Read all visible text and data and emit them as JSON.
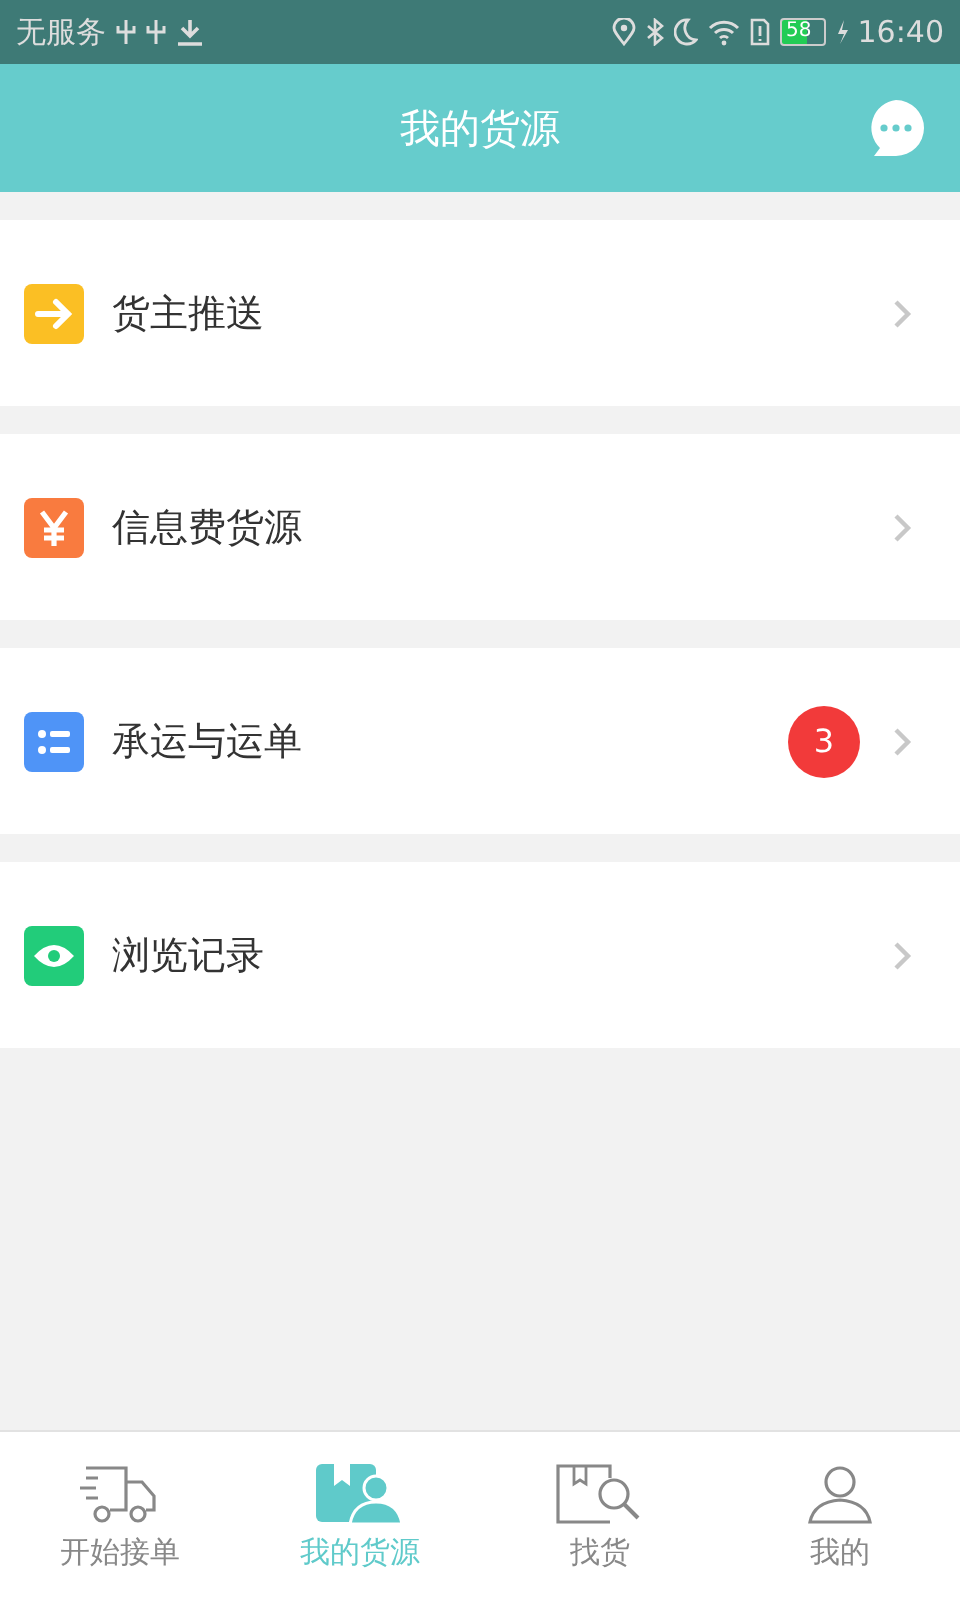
{
  "status_bar": {
    "carrier": "无服务",
    "battery": "58",
    "time": "16:40"
  },
  "header": {
    "title": "我的货源"
  },
  "menu": [
    {
      "label": "货主推送",
      "kind": "arrow",
      "color": "#fbbf24"
    },
    {
      "label": "信息费货源",
      "kind": "yen",
      "color": "#f97b3f"
    },
    {
      "label": "承运与运单",
      "kind": "list",
      "color": "#4f94f7",
      "badge": "3"
    },
    {
      "label": "浏览记录",
      "kind": "eye",
      "color": "#22cc7a"
    }
  ],
  "tabs": [
    {
      "label": "开始接单",
      "kind": "truck",
      "selected": false
    },
    {
      "label": "我的货源",
      "kind": "cargo",
      "selected": true
    },
    {
      "label": "找货",
      "kind": "search",
      "selected": false
    },
    {
      "label": "我的",
      "kind": "person",
      "selected": false
    }
  ]
}
